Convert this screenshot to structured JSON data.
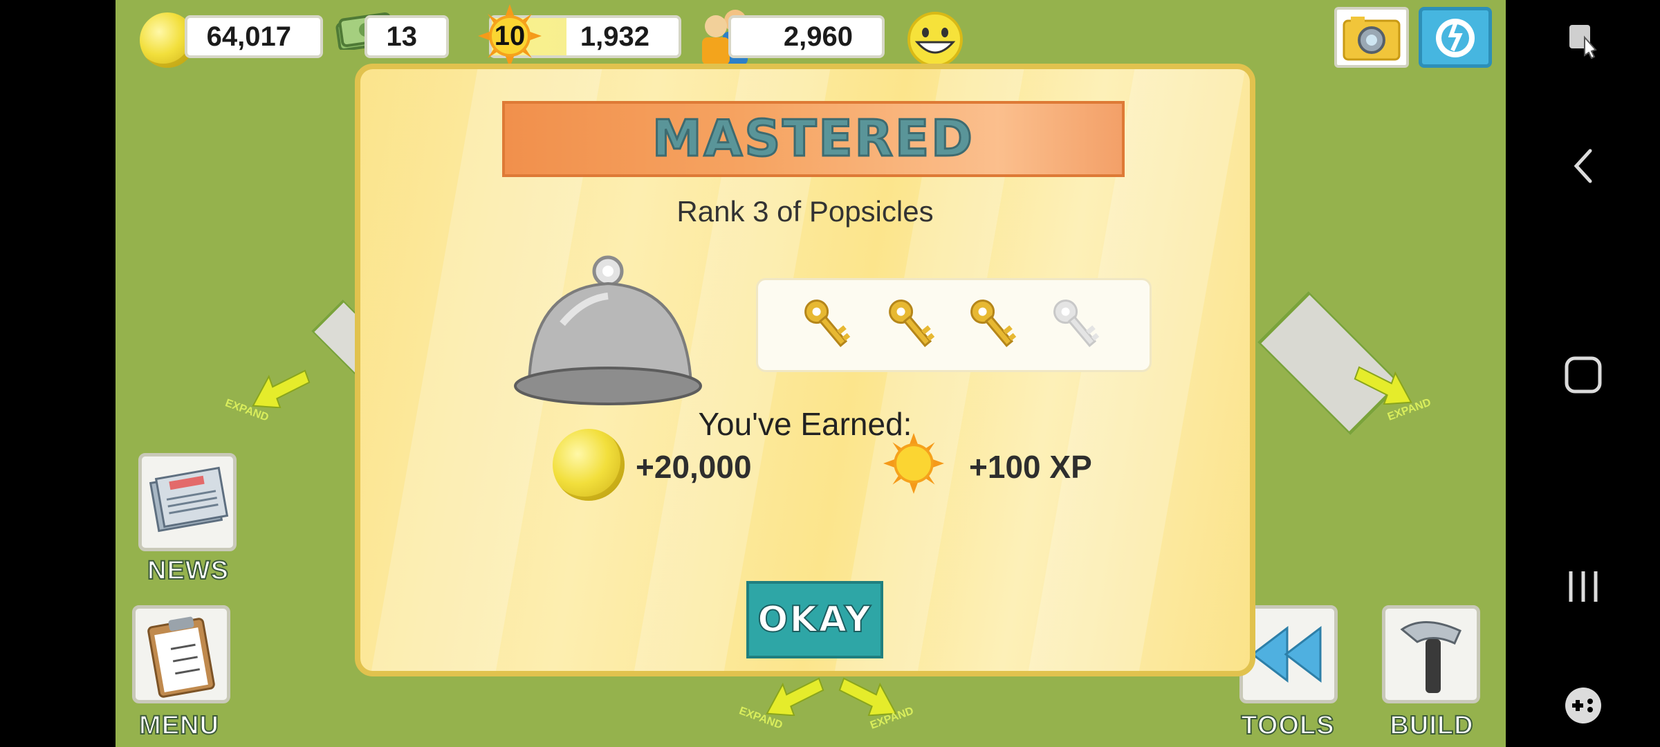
{
  "hud": {
    "coins": "64,017",
    "cash": "13",
    "level": "10",
    "xp": "1,932",
    "population": "2,960"
  },
  "modal": {
    "banner": "MASTERED",
    "subtitle": "Rank 3 of Popsicles",
    "rank": 3,
    "rank_max": 4,
    "earned_label": "You've Earned:",
    "reward_coins": "+20,000",
    "reward_xp": "+100 XP",
    "okay_label": "OKAY"
  },
  "side": {
    "news_label": "NEWS",
    "menu_label": "MENU",
    "tools_label": "TOOLS",
    "build_label": "BUILD",
    "expand_label": "EXPAND"
  },
  "colors": {
    "grass": "#95b24d",
    "modal_bg": "#fce58c",
    "banner": "#f1904c",
    "okay": "#2ea6a6",
    "key_gold": "#e7b832",
    "key_gray": "#dcdcdc"
  }
}
